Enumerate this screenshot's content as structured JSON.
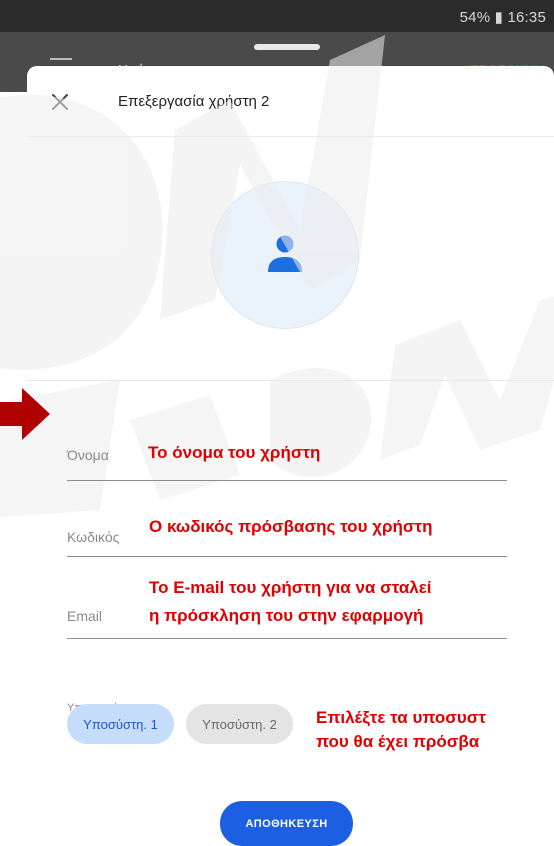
{
  "status_bar": {
    "text": "54% ▮ 16:35"
  },
  "app_bar": {
    "title": "Χρήστες",
    "action": "ΠΡΟΣΘΗΚΗ"
  },
  "sheet": {
    "title": "Επεξεργασία χρήστη 2"
  },
  "fields": {
    "name": {
      "label": "Όνομα",
      "annotation": "Το όνομα του χρήστη"
    },
    "password": {
      "label": "Κωδικός",
      "annotation": "Ο κωδικός πρόσβασης του χρήστη"
    },
    "email": {
      "label": "Email",
      "annotation_line1": "Το E-mail του χρήστη για να σταλεί",
      "annotation_line2": "η πρόσκληση του στην εφαρμογή"
    }
  },
  "subsystems": {
    "label": "Υποσυστήματα",
    "chips": [
      "Υποσύστη. 1",
      "Υποσύστη. 2"
    ],
    "annotation_line1": "Επιλέξτε τα υποσυστ",
    "annotation_line2": "που θα έχει πρόσβα"
  },
  "save_label": "ΑΠΟΘΗΚΕΥΣΗ",
  "colors": {
    "accent": "#1d5fe3",
    "annotation": "#e00000",
    "chip_selected": "#c6dcfb",
    "chip_unselected": "#e4e4e4"
  }
}
